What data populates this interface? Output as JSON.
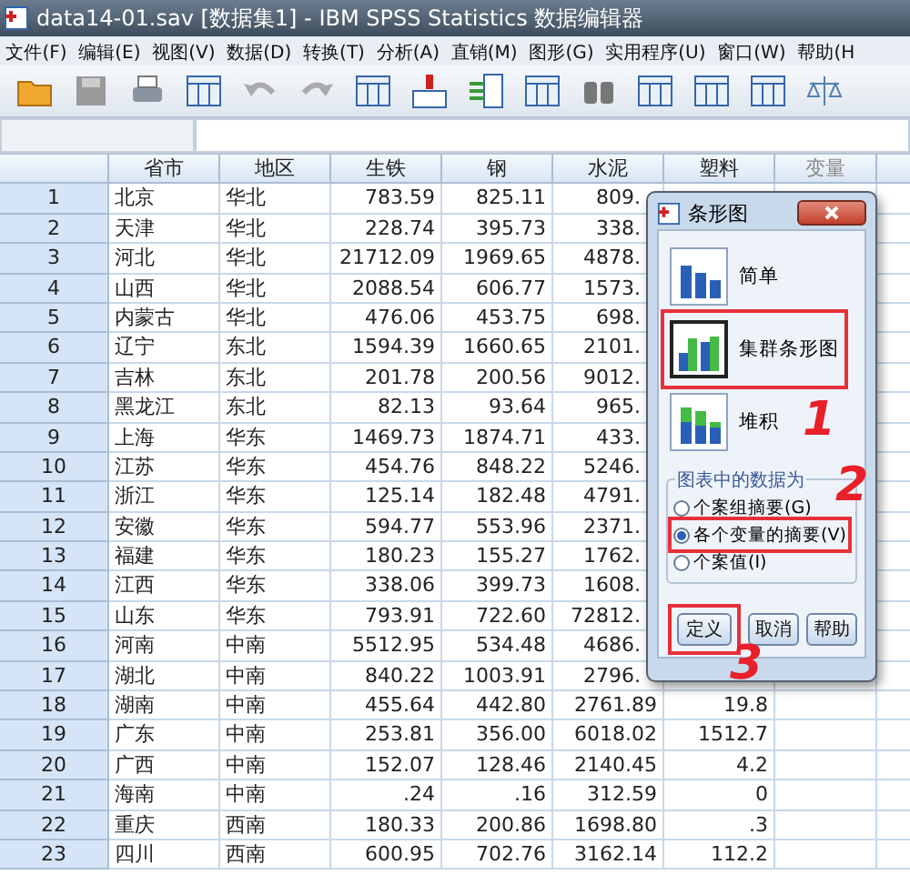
{
  "window": {
    "title": "data14-01.sav [数据集1] - IBM SPSS Statistics 数据编辑器"
  },
  "menu": [
    "文件(F)",
    "编辑(E)",
    "视图(V)",
    "数据(D)",
    "转换(T)",
    "分析(A)",
    "直销(M)",
    "图形(G)",
    "实用程序(U)",
    "窗口(W)",
    "帮助(H"
  ],
  "table": {
    "columns": [
      {
        "label": "省市",
        "kind": "text"
      },
      {
        "label": "地区",
        "kind": "text"
      },
      {
        "label": "生铁",
        "kind": "num"
      },
      {
        "label": "钢",
        "kind": "num"
      },
      {
        "label": "水泥",
        "kind": "num"
      },
      {
        "label": "塑料",
        "kind": "num"
      },
      {
        "label": "变量",
        "kind": "empty"
      }
    ],
    "rows": [
      {
        "num": "1",
        "cells": [
          "北京",
          "华北",
          "783.59",
          "825.11",
          "809."
        ]
      },
      {
        "num": "2",
        "cells": [
          "天津",
          "华北",
          "228.74",
          "395.73",
          "338."
        ]
      },
      {
        "num": "3",
        "cells": [
          "河北",
          "华北",
          "21712.09",
          "1969.65",
          "4878."
        ]
      },
      {
        "num": "4",
        "cells": [
          "山西",
          "华北",
          "2088.54",
          "606.77",
          "1573."
        ]
      },
      {
        "num": "5",
        "cells": [
          "内蒙古",
          "华北",
          "476.06",
          "453.75",
          "698."
        ]
      },
      {
        "num": "6",
        "cells": [
          "辽宁",
          "东北",
          "1594.39",
          "1660.65",
          "2101."
        ]
      },
      {
        "num": "7",
        "cells": [
          "吉林",
          "东北",
          "201.78",
          "200.56",
          "9012."
        ]
      },
      {
        "num": "8",
        "cells": [
          "黑龙江",
          "东北",
          "82.13",
          "93.64",
          "965."
        ]
      },
      {
        "num": "9",
        "cells": [
          "上海",
          "华东",
          "1469.73",
          "1874.71",
          "433."
        ]
      },
      {
        "num": "10",
        "cells": [
          "江苏",
          "华东",
          "454.76",
          "848.22",
          "5246."
        ]
      },
      {
        "num": "11",
        "cells": [
          "浙江",
          "华东",
          "125.14",
          "182.48",
          "4791."
        ]
      },
      {
        "num": "12",
        "cells": [
          "安徽",
          "华东",
          "594.77",
          "553.96",
          "2371."
        ]
      },
      {
        "num": "13",
        "cells": [
          "福建",
          "华东",
          "180.23",
          "155.27",
          "1762."
        ]
      },
      {
        "num": "14",
        "cells": [
          "江西",
          "华东",
          "338.06",
          "399.73",
          "1608."
        ]
      },
      {
        "num": "15",
        "cells": [
          "山东",
          "华东",
          "793.91",
          "722.60",
          "72812."
        ]
      },
      {
        "num": "16",
        "cells": [
          "河南",
          "中南",
          "5512.95",
          "534.48",
          "4686."
        ]
      },
      {
        "num": "17",
        "cells": [
          "湖北",
          "中南",
          "840.22",
          "1003.91",
          "2796."
        ]
      },
      {
        "num": "18",
        "cells": [
          "湖南",
          "中南",
          "455.64",
          "442.80",
          "2761.89",
          "19.8"
        ]
      },
      {
        "num": "19",
        "cells": [
          "广东",
          "中南",
          "253.81",
          "356.00",
          "6018.02",
          "1512.7"
        ]
      },
      {
        "num": "20",
        "cells": [
          "广西",
          "中南",
          "152.07",
          "128.46",
          "2140.45",
          "4.2"
        ]
      },
      {
        "num": "21",
        "cells": [
          "海南",
          "中南",
          ".24",
          ".16",
          "312.59",
          "0"
        ]
      },
      {
        "num": "22",
        "cells": [
          "重庆",
          "西南",
          "180.33",
          "200.86",
          "1698.80",
          ".3"
        ]
      },
      {
        "num": "23",
        "cells": [
          "四川",
          "西南",
          "600.95",
          "702.76",
          "3162.14",
          "112.2"
        ]
      }
    ]
  },
  "dialog": {
    "title": "条形图",
    "options": [
      {
        "label": "简单",
        "kind": "simple",
        "selected": false,
        "highlighted": false
      },
      {
        "label": "集群条形图",
        "kind": "clustered",
        "selected": true,
        "highlighted": true
      },
      {
        "label": "堆积",
        "kind": "stacked",
        "selected": false,
        "highlighted": false
      }
    ],
    "group_title": "图表中的数据为",
    "radios": [
      {
        "label": "个案组摘要(G)",
        "selected": false,
        "highlighted": false
      },
      {
        "label": "各个变量的摘要(V)",
        "selected": true,
        "highlighted": true
      },
      {
        "label": "个案值(I)",
        "selected": false,
        "highlighted": false
      }
    ],
    "buttons": [
      {
        "label": "定义",
        "highlighted": true
      },
      {
        "label": "取消",
        "highlighted": false
      },
      {
        "label": "帮助",
        "highlighted": false
      }
    ]
  },
  "annotations": [
    "1",
    "2",
    "3"
  ]
}
